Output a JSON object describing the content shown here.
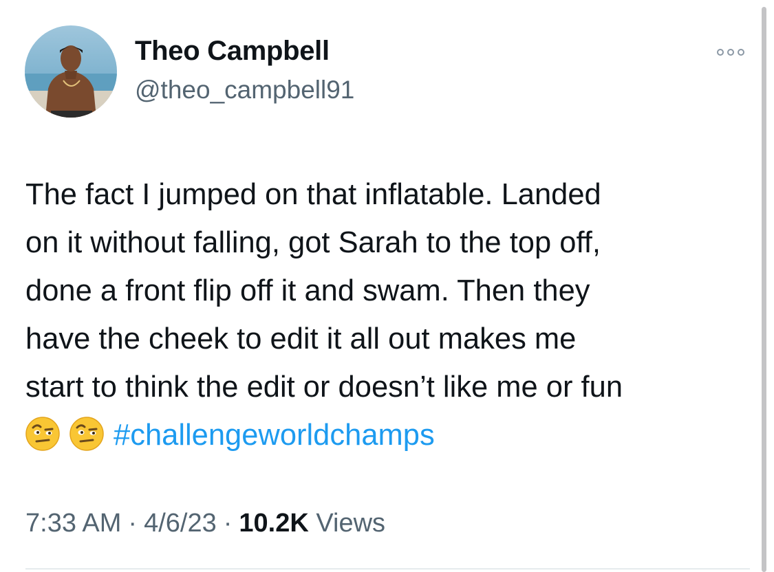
{
  "tweet": {
    "author": {
      "display_name": "Theo Campbell",
      "handle": "@theo_campbell91",
      "avatar_icon": "user-avatar-photo"
    },
    "text_lines": [
      "The fact I jumped on that inflatable. Landed",
      "on it without falling, got Sarah to the top off,",
      "done a front flip off it and swam. Then they",
      "have the cheek to edit it all out makes me",
      "start to think the edit or doesn’t like me or fun"
    ],
    "emojis": [
      "face-with-raised-eyebrow",
      "face-with-raised-eyebrow"
    ],
    "hashtag": "#challengeworldchamps",
    "time": "7:33 AM",
    "separator": "·",
    "date": "4/6/23",
    "views_count": "10.2K",
    "views_label": "Views",
    "more_icon": "more-horizontal-icon"
  },
  "colors": {
    "text": "#0f1419",
    "secondary": "#536471",
    "link": "#1d9bf0",
    "divider": "#cfd9de"
  }
}
